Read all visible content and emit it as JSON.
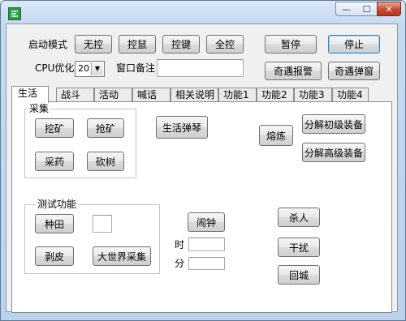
{
  "window": {
    "icon": "app-icon",
    "minimize_glyph": "—",
    "maximize_glyph": "☐",
    "close_glyph": "✕"
  },
  "top": {
    "start_mode_label": "启动模式",
    "btn_wukong": "无控",
    "btn_kongshu": "控鼠",
    "btn_kongjian": "控键",
    "btn_quankong": "全控",
    "btn_pause": "暂停",
    "btn_stop": "停止",
    "cpu_label": "CPU优化",
    "cpu_value": "20",
    "window_note_label": "窗口备注",
    "window_note_value": "",
    "btn_adventure_alarm": "奇遇报警",
    "btn_adventure_popup": "奇遇弹窗"
  },
  "tabs": [
    {
      "label": "生活",
      "active": true
    },
    {
      "label": "战斗",
      "active": false
    },
    {
      "label": "活动",
      "active": false
    },
    {
      "label": "喊话",
      "active": false
    },
    {
      "label": "相关说明",
      "active": false
    },
    {
      "label": "功能1",
      "active": false
    },
    {
      "label": "功能2",
      "active": false
    },
    {
      "label": "功能3",
      "active": false
    },
    {
      "label": "功能4",
      "active": false
    }
  ],
  "life": {
    "gather_group": "采集",
    "btn_mining": "挖矿",
    "btn_grab_ore": "抢矿",
    "btn_herb": "采药",
    "btn_chop": "砍树",
    "btn_life_piano": "生活弹琴",
    "btn_smelt": "熔炼",
    "btn_decompose_basic": "分解初级装备",
    "btn_decompose_advanced": "分解高级装备",
    "test_group": "测试功能",
    "btn_farm": "种田",
    "farm_value": "",
    "btn_skin": "剥皮",
    "btn_world_gather": "大世界采集",
    "btn_alarm": "闹钟",
    "hour_label": "时",
    "hour_value": "",
    "minute_label": "分",
    "minute_value": "",
    "btn_kill": "杀人",
    "btn_disturb": "干扰",
    "btn_return_city": "回城"
  }
}
